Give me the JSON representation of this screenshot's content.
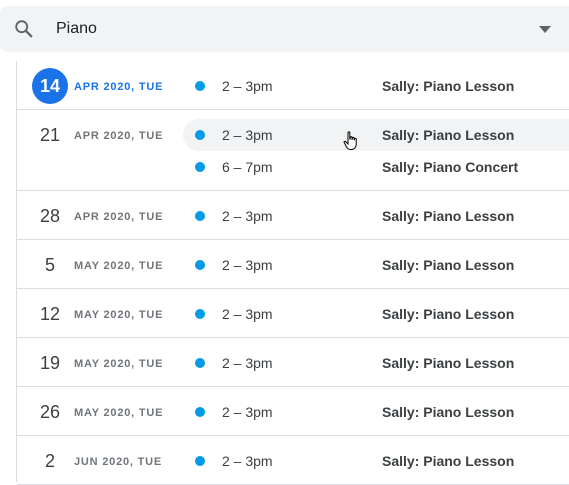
{
  "search": {
    "value": "Piano",
    "icon": "search-icon",
    "dropdown_icon": "chevron-down-icon"
  },
  "colors": {
    "accent": "#1a73e8",
    "event_dot": "#039be5"
  },
  "days": [
    {
      "day": "14",
      "meta": "APR 2020, TUE",
      "today": true,
      "events": [
        {
          "time": "2 – 3pm",
          "title": "Sally: Piano Lesson"
        }
      ]
    },
    {
      "day": "21",
      "meta": "APR 2020, TUE",
      "today": false,
      "events": [
        {
          "time": "2 – 3pm",
          "title": "Sally: Piano Lesson",
          "hover": true
        },
        {
          "time": "6 – 7pm",
          "title": "Sally: Piano Concert"
        }
      ]
    },
    {
      "day": "28",
      "meta": "APR 2020, TUE",
      "today": false,
      "events": [
        {
          "time": "2 – 3pm",
          "title": "Sally: Piano Lesson"
        }
      ]
    },
    {
      "day": "5",
      "meta": "MAY 2020, TUE",
      "today": false,
      "events": [
        {
          "time": "2 – 3pm",
          "title": "Sally: Piano Lesson"
        }
      ]
    },
    {
      "day": "12",
      "meta": "MAY 2020, TUE",
      "today": false,
      "events": [
        {
          "time": "2 – 3pm",
          "title": "Sally: Piano Lesson"
        }
      ]
    },
    {
      "day": "19",
      "meta": "MAY 2020, TUE",
      "today": false,
      "events": [
        {
          "time": "2 – 3pm",
          "title": "Sally: Piano Lesson"
        }
      ]
    },
    {
      "day": "26",
      "meta": "MAY 2020, TUE",
      "today": false,
      "events": [
        {
          "time": "2 – 3pm",
          "title": "Sally: Piano Lesson"
        }
      ]
    },
    {
      "day": "2",
      "meta": "JUN 2020, TUE",
      "today": false,
      "events": [
        {
          "time": "2 – 3pm",
          "title": "Sally: Piano Lesson"
        }
      ]
    }
  ]
}
